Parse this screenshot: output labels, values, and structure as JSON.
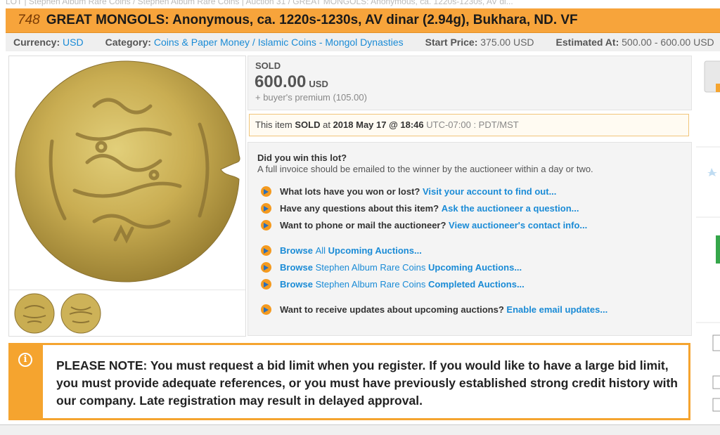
{
  "breadcrumb": "LOT  |  Stephen Album Rare Coins  /  Stephen Album Rare Coins | Auction 31  /  GREAT MONGOLS: Anonymous, ca. 1220s-1230s, AV di...",
  "lot": {
    "number": "748",
    "title": "GREAT MONGOLS: Anonymous, ca. 1220s-1230s, AV dinar (2.94g), Bukhara, ND. VF"
  },
  "meta": {
    "currency_label": "Currency:",
    "currency_value": "USD",
    "category_label": "Category:",
    "category_value": "Coins & Paper Money / Islamic Coins - Mongol Dynasties",
    "start_label": "Start Price:",
    "start_value": "375.00 USD",
    "estimate_label": "Estimated At:",
    "estimate_value": "500.00 - 600.00 USD"
  },
  "sold": {
    "label": "SOLD",
    "price": "600.00",
    "currency": "USD",
    "premium": "+ buyer's premium (105.00)"
  },
  "sold_info": {
    "prefix": "This item",
    "status": "SOLD",
    "at": "at",
    "datetime": "2018 May 17 @ 18:46",
    "timezone": "UTC-07:00 : PDT/MST"
  },
  "win": {
    "question": "Did you win this lot?",
    "subtext": "A full invoice should be emailed to the winner by the auctioneer within a day or two.",
    "row1_text": "What lots have you won or lost?",
    "row1_link": "Visit your account to find out...",
    "row2_text": "Have any questions about this item?",
    "row2_link": "Ask the auctioneer a question...",
    "row3_text": "Want to phone or mail the auctioneer?",
    "row3_link": "View auctioneer's contact info...",
    "row4_a": "Browse",
    "row4_b": "All",
    "row4_c": "Upcoming Auctions...",
    "row5_a": "Browse",
    "row5_b": "Stephen Album Rare Coins",
    "row5_c": "Upcoming Auctions...",
    "row6_a": "Browse",
    "row6_b": "Stephen Album Rare Coins",
    "row6_c": "Completed Auctions...",
    "row7_text": "Want to receive updates about upcoming auctions?",
    "row7_link": "Enable email updates..."
  },
  "note": {
    "icon": "i",
    "text": "PLEASE NOTE: You must request a bid limit when you register. If you would like to have a large bid limit, you must provide adequate references, or you must have previously established strong credit history with our company. Late registration may result in delayed approval."
  },
  "colors": {
    "title_bar": "#f7a43b",
    "link": "#1a8bd6",
    "note_border": "#f5a42f"
  },
  "icons": [
    "info-icon",
    "arrow-circle-icon"
  ]
}
